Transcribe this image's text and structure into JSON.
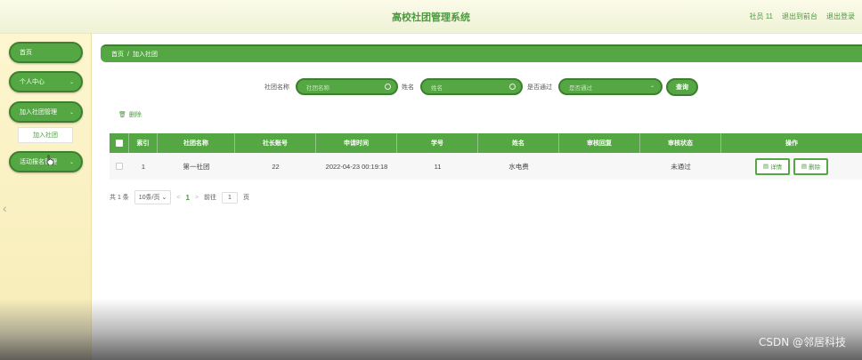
{
  "header": {
    "title": "高校社团管理系统",
    "user": "社员 11",
    "back_to_front": "退出到前台",
    "logout": "退出登录"
  },
  "sidebar": {
    "items": [
      {
        "label": "首页"
      },
      {
        "label": "个人中心"
      },
      {
        "label": "加入社团管理"
      },
      {
        "label": "活动报名管理"
      }
    ],
    "sub_item": "加入社团"
  },
  "breadcrumb": {
    "home": "首页",
    "separator": "/",
    "current": "加入社团"
  },
  "filters": {
    "club_name_label": "社团名称",
    "club_name_placeholder": "社团名称",
    "name_label": "姓名",
    "name_placeholder": "姓名",
    "approved_label": "是否通过",
    "approved_placeholder": "是否通过",
    "search_button": "查询"
  },
  "actions": {
    "delete_label": "删除"
  },
  "table": {
    "headers": [
      "索引",
      "社团名称",
      "社长账号",
      "申请时间",
      "学号",
      "姓名",
      "审核回复",
      "审核状态",
      "操作"
    ],
    "rows": [
      {
        "index": "1",
        "club_name": "第一社团",
        "president_account": "22",
        "apply_time": "2022-04-23 00:19:18",
        "student_id": "11",
        "name": "水电费",
        "review_reply": "",
        "review_status": "未通过",
        "detail_label": "详情",
        "delete_label": "删除"
      }
    ]
  },
  "pagination": {
    "total": "共 1 条",
    "page_size": "10条/页",
    "prev": "<",
    "current_page": "1",
    "next": ">",
    "goto_label": "前往",
    "goto_value": "1",
    "page_suffix": "页"
  },
  "watermark": "CSDN @邻居科技",
  "colors": {
    "accent": "#55a744",
    "accent_dark": "#3d7f30",
    "sidebar_bg": "#fdf6cf",
    "header_bg": "#fbfbe8"
  }
}
